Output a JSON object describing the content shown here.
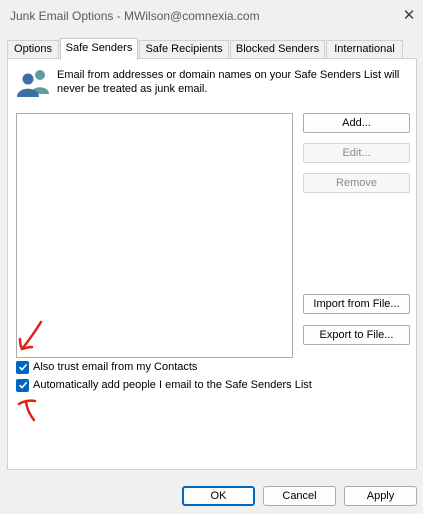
{
  "window": {
    "title": "Junk Email Options - MWilson@comnexia.com",
    "close_glyph": "✕"
  },
  "tabs": [
    {
      "label": "Options",
      "active": false
    },
    {
      "label": "Safe Senders",
      "active": true
    },
    {
      "label": "Safe Recipients",
      "active": false
    },
    {
      "label": "Blocked Senders",
      "active": false
    },
    {
      "label": "International",
      "active": false
    }
  ],
  "panel": {
    "icon": "people-icon",
    "description": "Email from addresses or domain names on your Safe Senders List will never be treated as junk email.",
    "list_items": [],
    "buttons": {
      "add": {
        "label": "Add...",
        "enabled": true
      },
      "edit": {
        "label": "Edit...",
        "enabled": false
      },
      "remove": {
        "label": "Remove",
        "enabled": false
      },
      "import": {
        "label": "Import from File...",
        "enabled": true
      },
      "export": {
        "label": "Export to File...",
        "enabled": true
      }
    },
    "checkboxes": [
      {
        "label": "Also trust email from my Contacts",
        "checked": true
      },
      {
        "label": "Automatically add people I email to the Safe Senders List",
        "checked": true
      }
    ]
  },
  "footer": {
    "ok": "OK",
    "cancel": "Cancel",
    "apply": "Apply"
  },
  "colors": {
    "accent": "#0067c0",
    "annotation": "#e0201b"
  }
}
